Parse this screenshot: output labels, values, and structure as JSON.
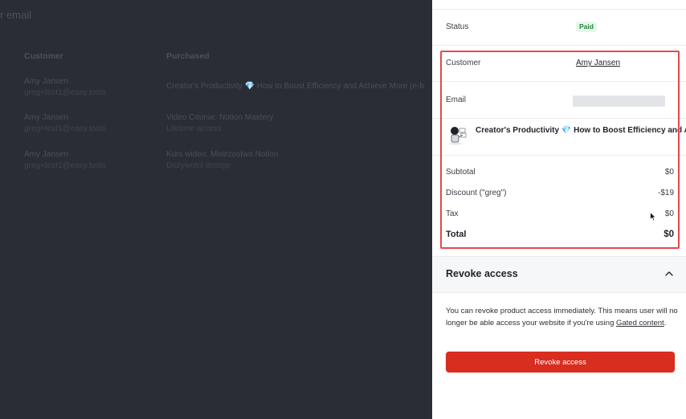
{
  "background": {
    "search_tail": "r email",
    "headers": {
      "customer": "Customer",
      "purchased": "Purchased"
    },
    "rows": [
      {
        "name": "Amy Jansen",
        "email": "greg+test1@easy.tools",
        "product_prefix": "Creator's Productivity ",
        "product_gem": "💎",
        "product_suffix": " How to Boost Efficiency and Achieve More (e-b",
        "product_sub": ""
      },
      {
        "name": "Amy Jansen",
        "email": "greg+test1@easy.tools",
        "product_prefix": "Video Course: Notion Mastery",
        "product_gem": "",
        "product_suffix": "",
        "product_sub": "Lifetime access"
      },
      {
        "name": "Amy Jansen",
        "email": "greg+test1@easy.tools",
        "product_prefix": "Kurs wideo: Mistrzostwo Notion",
        "product_gem": "",
        "product_suffix": "",
        "product_sub": "Dożywotni dostęp"
      }
    ]
  },
  "drawer": {
    "status_label": "Status",
    "status_value": "Paid",
    "customer_label": "Customer",
    "customer_value": "Amy Jansen",
    "email_label": "Email",
    "product_prefix": "Creator's Productivity ",
    "product_gem": "💎",
    "product_suffix": " How to Boost Efficiency and Ac",
    "subtotal_label": "Subtotal",
    "subtotal_value": "$0",
    "discount_label": "Discount (\"greg\")",
    "discount_value": "-$19",
    "tax_label": "Tax",
    "tax_value": "$0",
    "total_label": "Total",
    "total_value": "$0",
    "revoke_section_title": "Revoke access",
    "revoke_desc_text": "You can revoke product access immediately. This means user will no longer be able access your website if you're using ",
    "revoke_desc_link": "Gated content",
    "revoke_desc_end": ".",
    "revoke_button": "Revoke access"
  },
  "colors": {
    "overlay_bg": "#2b2d35",
    "paid_badge": "#1b8a3c",
    "highlight_border": "#e5484d",
    "danger_button": "#d92d20"
  }
}
